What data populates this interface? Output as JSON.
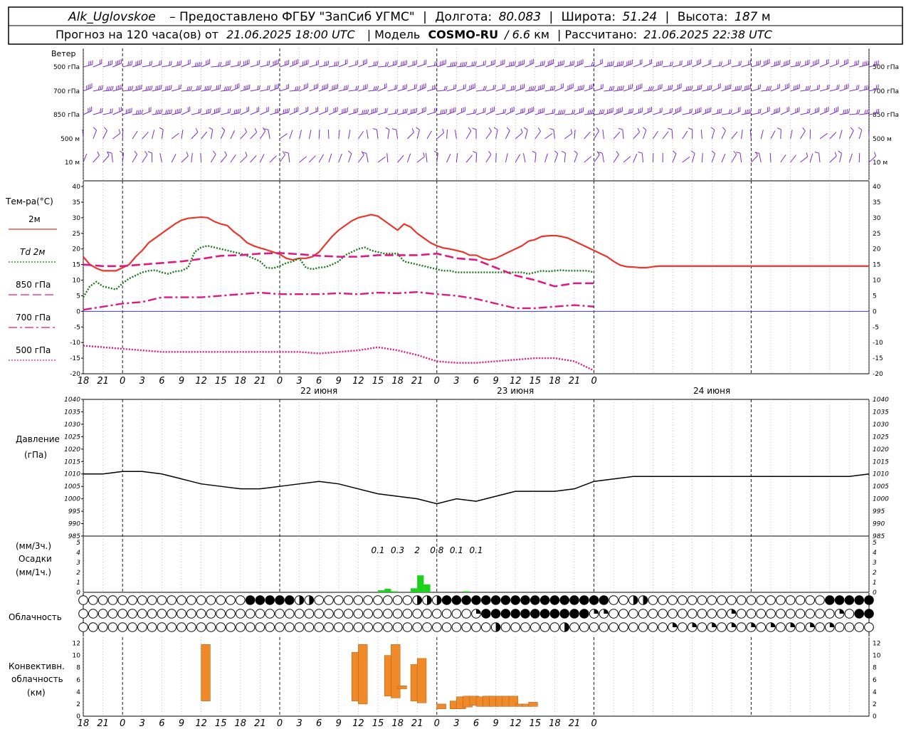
{
  "header": {
    "station": "Alk_Uglovskoe",
    "provider": "– Предоставлено ФГБУ \"ЗапСиб УГМС\"",
    "lon_label": "Долгота:",
    "lon_value": "80.083",
    "lat_label": "Широта:",
    "lat_value": "51.24",
    "alt_label": "Высота:",
    "alt_value": "187",
    "alt_unit": "м",
    "forecast_label": "Прогноз на 120 часа(ов) от",
    "forecast_from": "21.06.2025 18:00 UTC",
    "model_label": "| Модель",
    "model_name": "COSMO-RU",
    "model_res": "/ 6.6",
    "model_res_unit": "км",
    "computed_label": "| Рассчитано:",
    "computed_at": "21.06.2025 22:38 UTC"
  },
  "panels": {
    "wind_title": "Ветер",
    "wind_levels": [
      "500 гПа",
      "700 гПа",
      "850 гПа",
      "500  м",
      "10  м"
    ],
    "temp_title": "Тем-ра(°C)",
    "temp_legend": [
      {
        "label": "2м",
        "color": "#e8362b",
        "style": "solid"
      },
      {
        "label": "Td  2м",
        "color": "#1a7a1a",
        "style": "dotted"
      },
      {
        "label": "850 гПа",
        "color": "#dd1a84",
        "style": "dashed"
      },
      {
        "label": "700 гПа",
        "color": "#dd1a84",
        "style": "dashdot"
      },
      {
        "label": "500 гПа",
        "color": "#dd1a84",
        "style": "dotted"
      }
    ],
    "pressure_title": "Давление",
    "pressure_unit": "(гПа)",
    "precip_unit_3h": "(мм/3ч.)",
    "precip_title": "Осадки",
    "precip_unit_1h": "(мм/1ч.)",
    "cloud_title": "Облачность",
    "conv_title_1": "Конвективн.",
    "conv_title_2": "облачность",
    "conv_unit": "(км)"
  },
  "x_axis": {
    "tick_labels": [
      "18",
      "21",
      "0",
      "3",
      "6",
      "9",
      "12",
      "15",
      "18",
      "21",
      "0",
      "3",
      "6",
      "9",
      "12",
      "15",
      "18",
      "21",
      "0",
      "3",
      "6",
      "9",
      "12",
      "15",
      "18",
      "21",
      "0"
    ],
    "day_labels": [
      "22 июня",
      "23 июня",
      "24 июня"
    ]
  },
  "chart_data": [
    {
      "type": "line",
      "title": "Тем-ра(°C)",
      "x_hours": [
        0,
        3,
        6,
        9,
        12,
        15,
        18,
        21,
        24,
        27,
        30,
        33,
        36,
        39,
        42,
        45,
        48,
        51,
        54,
        57,
        60,
        63,
        66,
        69,
        72
      ],
      "ylim": [
        -20,
        40
      ],
      "yticks": [
        -20,
        -15,
        -10,
        -5,
        0,
        5,
        10,
        15,
        20,
        25,
        30,
        35,
        40
      ],
      "series": [
        {
          "name": "2м",
          "color": "#e8362b",
          "x": [
            0,
            1,
            2,
            3,
            4,
            5,
            6,
            7,
            8,
            9,
            10,
            11,
            12,
            13,
            14,
            15,
            16,
            17,
            18,
            19,
            20,
            21,
            22,
            23,
            24,
            25,
            26,
            27,
            28,
            29,
            30,
            31,
            32,
            33,
            34,
            35,
            36,
            37,
            38,
            39,
            40,
            41,
            42,
            43,
            44,
            45,
            46,
            47,
            48,
            49,
            50,
            51,
            52,
            53,
            54,
            55,
            56,
            57,
            58,
            59,
            60,
            61,
            62,
            63,
            64,
            65,
            66,
            67,
            68,
            69,
            70,
            71,
            72,
            73,
            74,
            75,
            76,
            77,
            78,
            79,
            80,
            81,
            82,
            83,
            84,
            85,
            86,
            87,
            88,
            89,
            90,
            91,
            92,
            93,
            94,
            95,
            96,
            97,
            98,
            99,
            100,
            101,
            102,
            103,
            104,
            105,
            106,
            107,
            108,
            109,
            110,
            111,
            112,
            113,
            114,
            115,
            116,
            117,
            118,
            119,
            120
          ],
          "y": [
            17.5,
            15,
            13.8,
            13,
            13,
            13,
            14,
            15,
            17.5,
            19.5,
            22,
            23.5,
            25,
            26.5,
            28,
            29.2,
            29.8,
            30,
            30.2,
            30,
            28.8,
            28,
            27.5,
            25.5,
            24,
            22,
            21,
            20.3,
            19.7,
            19,
            18.3,
            17,
            16.5,
            17,
            17,
            17.5,
            19,
            21.5,
            24,
            26,
            27.5,
            29,
            30,
            30.5,
            31,
            30.5,
            29,
            27.5,
            26,
            28,
            27,
            25,
            23.5,
            22,
            21,
            20.3,
            20,
            19.5,
            19,
            18,
            18,
            17,
            16.5,
            17,
            18,
            19,
            20,
            21,
            22.5,
            23,
            24,
            24.2,
            24.3,
            24,
            23.5,
            22.5,
            21.5,
            20.5,
            19.5,
            18.5,
            17.5,
            16,
            14.8,
            14.3,
            14.2,
            14,
            14,
            14.3,
            14.5,
            14.5,
            14.5,
            14.5,
            14.5,
            14.5,
            14.5,
            14.5,
            14.5,
            14.5,
            14.5,
            14.5,
            14.5,
            14.5,
            14.5,
            14.5,
            14.5,
            14.5,
            14.5,
            14.5,
            14.5,
            14.5,
            14.5,
            14.5,
            14.5,
            14.5,
            14.5,
            14.5,
            14.5,
            14.5,
            14.5,
            14.5,
            14.5
          ]
        },
        {
          "name": "Td 2м",
          "color": "#1a7a1a",
          "x": [
            0,
            1,
            2,
            3,
            4,
            5,
            6,
            7,
            8,
            9,
            10,
            11,
            12,
            13,
            14,
            15,
            16,
            17,
            18,
            19,
            20,
            21,
            22,
            23,
            24,
            25,
            26,
            27,
            28,
            29,
            30,
            31,
            32,
            33,
            34,
            35,
            36,
            37,
            38,
            39,
            40,
            41,
            42,
            43,
            44,
            45,
            46,
            47,
            48,
            49,
            50,
            51,
            52,
            53,
            54,
            55,
            56,
            57,
            58,
            59,
            60,
            61,
            62,
            63,
            64,
            65,
            66,
            67,
            68,
            69,
            70,
            71,
            72,
            73,
            74,
            75,
            76,
            77,
            78
          ],
          "y": [
            4.5,
            8,
            9.5,
            8,
            7.5,
            7,
            9,
            10.5,
            11.5,
            12.5,
            13,
            13.2,
            12.5,
            12,
            12.8,
            13,
            14,
            19,
            20.5,
            21,
            20.5,
            20,
            19.5,
            19,
            18.5,
            17.8,
            17,
            16,
            14,
            13.8,
            14.5,
            15.5,
            16,
            17,
            14,
            13.5,
            14,
            14.2,
            15,
            16,
            18,
            19,
            20,
            20.5,
            19.5,
            19,
            18.5,
            18.5,
            18.5,
            16,
            15.5,
            15,
            14.5,
            14,
            13.5,
            13,
            13,
            12.5,
            12.5,
            12.5,
            12.5,
            12.5,
            12.5,
            12.5,
            12.5,
            12.5,
            12.5,
            12.5,
            12,
            12.5,
            13,
            12.8,
            13,
            13.2,
            13,
            13,
            13,
            13,
            12.5
          ]
        },
        {
          "name": "850 гПа",
          "color": "#dd1a84",
          "x": [
            0,
            3,
            6,
            9,
            12,
            15,
            18,
            21,
            24,
            27,
            30,
            33,
            36,
            39,
            42,
            45,
            48,
            51,
            54,
            57,
            60,
            63,
            66,
            69,
            72,
            75,
            78
          ],
          "y": [
            15,
            14.5,
            14.5,
            15,
            15.5,
            16,
            16.8,
            17.8,
            18,
            18.5,
            18.7,
            18.3,
            17.8,
            17.5,
            17.5,
            18,
            18,
            18,
            18.5,
            17,
            16.5,
            14,
            11.5,
            10,
            8,
            9,
            9
          ]
        },
        {
          "name": "700 гПа",
          "color": "#dd1a84",
          "x": [
            0,
            3,
            6,
            9,
            12,
            15,
            18,
            21,
            24,
            27,
            30,
            33,
            36,
            39,
            42,
            45,
            48,
            51,
            54,
            57,
            60,
            63,
            66,
            69,
            72,
            75,
            78
          ],
          "y": [
            0.5,
            1.5,
            2.5,
            3,
            4.5,
            4.5,
            4.5,
            5,
            5.5,
            6,
            5.5,
            5.5,
            5.5,
            5.8,
            5.5,
            6,
            5.8,
            6.2,
            5.5,
            5,
            4,
            2.5,
            1,
            1,
            1.5,
            2,
            1.5
          ]
        },
        {
          "name": "500 гПа",
          "color": "#dd1a84",
          "x": [
            0,
            3,
            6,
            9,
            12,
            15,
            18,
            21,
            24,
            27,
            30,
            33,
            36,
            39,
            42,
            45,
            48,
            51,
            54,
            57,
            60,
            63,
            66,
            69,
            72,
            75,
            78
          ],
          "y": [
            -11,
            -11.5,
            -12,
            -12.5,
            -13,
            -13,
            -13,
            -13,
            -13,
            -13,
            -13,
            -13,
            -13.5,
            -13,
            -12.5,
            -11.5,
            -12.5,
            -14,
            -16,
            -16.5,
            -16.5,
            -16,
            -15.5,
            -15,
            -15,
            -16,
            -19
          ]
        }
      ]
    },
    {
      "type": "line",
      "title": "Давление",
      "ylabel": "(гПа)",
      "ylim": [
        985,
        1040
      ],
      "yticks": [
        985,
        990,
        995,
        1000,
        1005,
        1010,
        1015,
        1020,
        1025,
        1030,
        1035,
        1040
      ],
      "series": [
        {
          "name": "Давление",
          "color": "#000000",
          "x": [
            0,
            3,
            6,
            9,
            12,
            15,
            18,
            21,
            24,
            27,
            30,
            33,
            36,
            39,
            42,
            45,
            48,
            51,
            54,
            57,
            60,
            63,
            66,
            69,
            72,
            75,
            78,
            81,
            84,
            87,
            90,
            93,
            96,
            99,
            102,
            105,
            108,
            111,
            114,
            117,
            120
          ],
          "y": [
            1010,
            1010,
            1011,
            1011,
            1010,
            1008,
            1006,
            1005,
            1004,
            1004,
            1005,
            1006,
            1007,
            1006,
            1004,
            1002,
            1001,
            1000,
            998,
            1000,
            999,
            1001,
            1003,
            1003,
            1003,
            1004,
            1007,
            1008,
            1009,
            1009,
            1009,
            1009,
            1009,
            1009,
            1009,
            1009,
            1009,
            1009,
            1009,
            1009,
            1010
          ]
        }
      ]
    },
    {
      "type": "bar",
      "title": "Осадки",
      "ylim": [
        0,
        5
      ],
      "yticks": [
        0,
        1,
        2,
        3,
        4,
        5
      ],
      "labels_3h": [
        {
          "x_hour": 45,
          "text": "0.1"
        },
        {
          "x_hour": 48,
          "text": "0.3"
        },
        {
          "x_hour": 51,
          "text": "2"
        },
        {
          "x_hour": 54,
          "text": "0.8"
        },
        {
          "x_hour": 57,
          "text": "0.1"
        },
        {
          "x_hour": 60,
          "text": "0.1"
        }
      ],
      "bars_1h": [
        {
          "x_hour": 45,
          "value": 0.2
        },
        {
          "x_hour": 46,
          "value": 0.35
        },
        {
          "x_hour": 47,
          "value": 0.1
        },
        {
          "x_hour": 50,
          "value": 0.4
        },
        {
          "x_hour": 51,
          "value": 1.7
        },
        {
          "x_hour": 52,
          "value": 0.8
        },
        {
          "x_hour": 58,
          "value": 0.1
        }
      ]
    },
    {
      "type": "bar",
      "title": "Конвективн. облачность",
      "ylabel": "(км)",
      "ylim": [
        0,
        13
      ],
      "yticks": [
        0,
        2,
        4,
        6,
        8,
        10,
        12
      ],
      "bars": [
        {
          "x_hour": 18,
          "bottom": 2.5,
          "top": 11.8
        },
        {
          "x_hour": 41,
          "bottom": 2.5,
          "top": 10.5
        },
        {
          "x_hour": 42,
          "bottom": 2.0,
          "top": 11.8
        },
        {
          "x_hour": 46,
          "bottom": 3.3,
          "top": 10.0
        },
        {
          "x_hour": 47,
          "bottom": 3.0,
          "top": 11.8
        },
        {
          "x_hour": 48,
          "bottom": 4.5,
          "top": 5.0
        },
        {
          "x_hour": 50,
          "bottom": 2.5,
          "top": 8.5
        },
        {
          "x_hour": 51,
          "bottom": 2.2,
          "top": 9.5
        },
        {
          "x_hour": 54,
          "bottom": 1.2,
          "top": 2.0
        },
        {
          "x_hour": 56,
          "bottom": 1.2,
          "top": 2.5
        },
        {
          "x_hour": 57,
          "bottom": 1.2,
          "top": 3.2
        },
        {
          "x_hour": 58,
          "bottom": 1.5,
          "top": 3.3
        },
        {
          "x_hour": 59,
          "bottom": 1.8,
          "top": 3.3
        },
        {
          "x_hour": 60,
          "bottom": 1.6,
          "top": 3.2
        },
        {
          "x_hour": 61,
          "bottom": 1.6,
          "top": 3.3
        },
        {
          "x_hour": 62,
          "bottom": 1.6,
          "top": 3.3
        },
        {
          "x_hour": 63,
          "bottom": 1.6,
          "top": 3.3
        },
        {
          "x_hour": 64,
          "bottom": 1.6,
          "top": 3.3
        },
        {
          "x_hour": 65,
          "bottom": 1.6,
          "top": 3.3
        },
        {
          "x_hour": 66,
          "bottom": 1.6,
          "top": 2.0
        },
        {
          "x_hour": 67,
          "bottom": 1.6,
          "top": 2.0
        },
        {
          "x_hour": 68,
          "bottom": 1.6,
          "top": 2.3
        }
      ]
    }
  ],
  "colors": {
    "temp_2m": "#e8362b",
    "dewpoint": "#1a7a1a",
    "upper_temp": "#dd1a84",
    "wind": "#7a2fc4",
    "pressure": "#000000",
    "precip": "#1bd11b",
    "conv_cloud": "#ef8a2b"
  }
}
